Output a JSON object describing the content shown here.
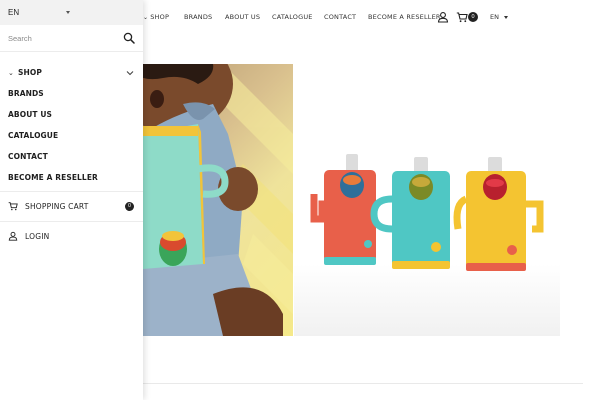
{
  "topnav": {
    "items": [
      {
        "label": "SHOP",
        "has_caret": true
      },
      {
        "label": "BRANDS"
      },
      {
        "label": "ABOUT US"
      },
      {
        "label": "CATALOGUE"
      },
      {
        "label": "CONTACT"
      },
      {
        "label": "BECOME A RESELLER"
      }
    ],
    "account_icon": "user-icon",
    "cart_icon": "cart-icon",
    "cart_count": "0",
    "language": "EN"
  },
  "drawer": {
    "language": "EN",
    "search": {
      "placeholder": "Search",
      "value": "",
      "icon": "search-icon"
    },
    "menu": [
      {
        "label": "SHOP",
        "expandable": true
      },
      {
        "label": "BRANDS"
      },
      {
        "label": "ABOUT US"
      },
      {
        "label": "CATALOGUE"
      },
      {
        "label": "CONTACT"
      },
      {
        "label": "BECOME A RESELLER"
      }
    ],
    "cart": {
      "label": "SHOPPING CART",
      "count": "0",
      "icon": "cart-icon"
    },
    "login": {
      "label": "LOGIN",
      "icon": "user-icon"
    }
  },
  "hero": {
    "left_image": "child-holding-teal-pouch-holder",
    "right_image": "three-pouch-holders-red-teal-yellow",
    "product_colors": [
      "#e8604a",
      "#4fc7c4",
      "#f4c431"
    ]
  }
}
